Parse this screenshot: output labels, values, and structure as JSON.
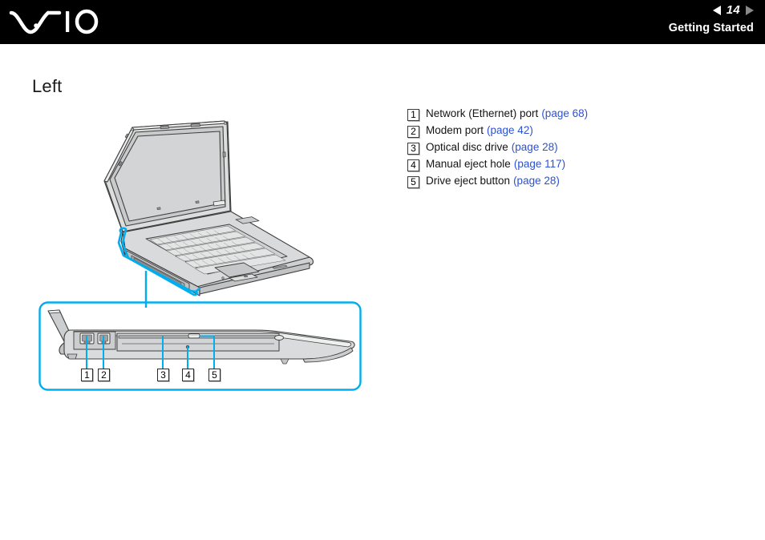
{
  "header": {
    "logo_name": "VAIO",
    "prev_arrow_icon": "triangle-left-icon",
    "next_arrow_icon": "triangle-right-icon",
    "page_number": "14",
    "section": "Getting Started"
  },
  "main": {
    "title": "Left"
  },
  "legend": {
    "items": [
      {
        "num": "1",
        "label": "Network (Ethernet) port",
        "link": "(page 68)"
      },
      {
        "num": "2",
        "label": "Modem port",
        "link": "(page 42)"
      },
      {
        "num": "3",
        "label": "Optical disc drive",
        "link": "(page 28)"
      },
      {
        "num": "4",
        "label": "Manual eject hole",
        "link": "(page 117)"
      },
      {
        "num": "5",
        "label": "Drive eject button",
        "link": "(page 28)"
      }
    ]
  },
  "diagram": {
    "top_illustration_name": "open-laptop-front-left-view",
    "detail_illustration_name": "laptop-left-side-edge-detail",
    "callouts": [
      {
        "num": "1",
        "target": "ethernet-port"
      },
      {
        "num": "2",
        "target": "modem-port"
      },
      {
        "num": "3",
        "target": "optical-disc-drive"
      },
      {
        "num": "4",
        "target": "manual-eject-hole"
      },
      {
        "num": "5",
        "target": "drive-eject-button"
      }
    ]
  },
  "colors": {
    "header_bg": "#000000",
    "link": "#2b52d4",
    "callout_cyan": "#00ADEE",
    "illustration_fill": "#d9dadb",
    "illustration_stroke": "#3f3f3f"
  }
}
